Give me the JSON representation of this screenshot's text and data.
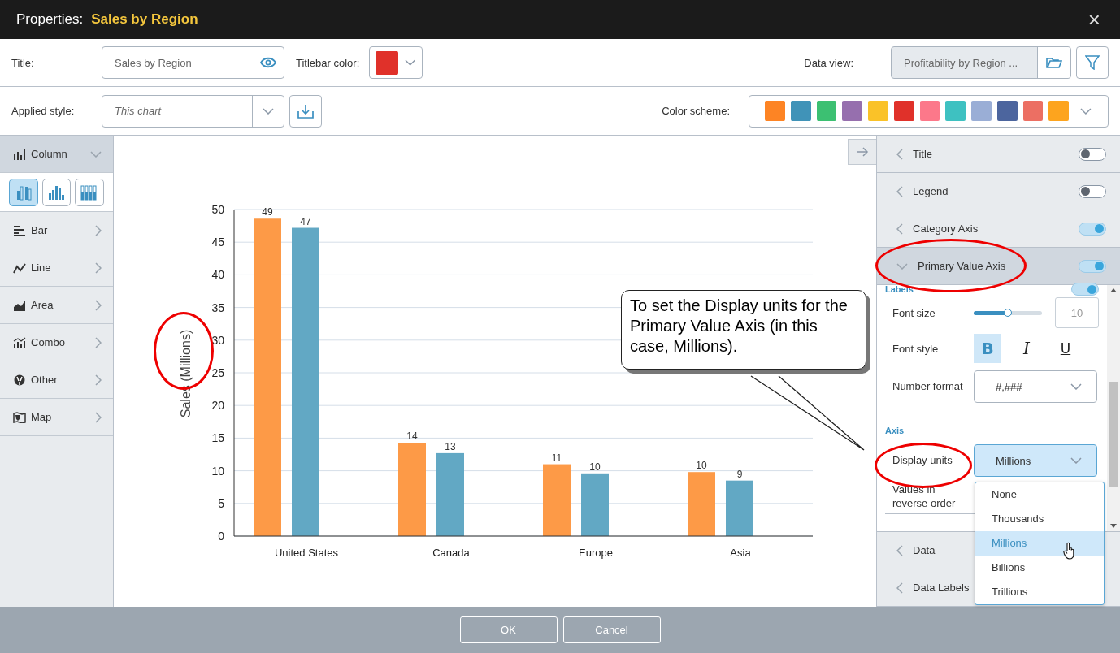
{
  "header": {
    "label": "Properties:",
    "title": "Sales by Region",
    "close": "×"
  },
  "general": {
    "title_label": "Title:",
    "title_value": "Sales by Region",
    "titlebar_color_label": "Titlebar color:",
    "titlebar_swatch": {
      "color": "#e0312a"
    },
    "data_view_label": "Data view:",
    "data_view_value": "Profitability by Region ...",
    "applied_style_label": "Applied style:",
    "applied_style_value": "This chart",
    "color_scheme_label": "Color scheme:",
    "color_scheme": [
      {
        "color": "#fd8424"
      },
      {
        "color": "#4093b8"
      },
      {
        "color": "#3cc072"
      },
      {
        "color": "#966fae"
      },
      {
        "color": "#fac228"
      },
      {
        "color": "#e0312a"
      },
      {
        "color": "#fc788a"
      },
      {
        "color": "#3ec1c1"
      },
      {
        "color": "#9aaed6"
      },
      {
        "color": "#4c659e"
      },
      {
        "color": "#ec6f63"
      },
      {
        "color": "#fda41e"
      }
    ]
  },
  "chart_types": [
    {
      "label": "Column",
      "kind": "column",
      "expanded": true
    },
    {
      "label": "Bar",
      "kind": "bar",
      "expanded": false
    },
    {
      "label": "Line",
      "kind": "line",
      "expanded": false
    },
    {
      "label": "Area",
      "kind": "area",
      "expanded": false
    },
    {
      "label": "Combo",
      "kind": "combo",
      "expanded": false
    },
    {
      "label": "Other",
      "kind": "other",
      "expanded": false
    },
    {
      "label": "Map",
      "kind": "map",
      "expanded": false
    }
  ],
  "column_subtypes": [
    {
      "kind": "clustered",
      "selected": true
    },
    {
      "kind": "mixed",
      "selected": false
    },
    {
      "kind": "stacked",
      "selected": false
    }
  ],
  "chart": {
    "chart_data": {
      "type": "bar",
      "ylabel": "Sales (Millions)",
      "categories": [
        "United States",
        "Canada",
        "Europe",
        "Asia"
      ],
      "series": [
        {
          "color": "#fd9a47",
          "values": [
            48.6,
            14.3,
            11,
            9.8
          ],
          "value_labels": [
            "49",
            "14",
            "11",
            "10"
          ]
        },
        {
          "color": "#62a8c4",
          "values": [
            47.2,
            12.7,
            9.6,
            8.5
          ],
          "value_labels": [
            "47",
            "13",
            "10",
            "9"
          ]
        }
      ],
      "grid": true,
      "ylim": [
        0,
        50
      ],
      "yticks": [
        0,
        5,
        10,
        15,
        20,
        25,
        30,
        35,
        40,
        45,
        50
      ],
      "data_labels": true
    }
  },
  "callout": {
    "text": "To set the Display units for the Primary Value Axis (in this case, Millions)."
  },
  "panel": {
    "sections": [
      {
        "label": "Title",
        "on": false,
        "expanded": false
      },
      {
        "label": "Legend",
        "on": false,
        "expanded": false
      },
      {
        "label": "Category Axis",
        "on": true,
        "expanded": false
      },
      {
        "label": "Primary Value Axis",
        "on": true,
        "expanded": true
      }
    ],
    "labels_heading": "Labels",
    "labels_on": true,
    "font_size": {
      "label": "Font size",
      "level": 0.5,
      "value": "10"
    },
    "font_style": {
      "label": "Font style",
      "buttons": [
        {
          "glyph": "B",
          "kind": "bold",
          "selected": true
        },
        {
          "glyph": "I",
          "kind": "italic",
          "selected": false
        },
        {
          "glyph": "U",
          "kind": "underline",
          "selected": false
        }
      ]
    },
    "number_format": {
      "label": "Number format",
      "value": "#,###"
    },
    "axis_heading": "Axis",
    "display_units": {
      "label": "Display units",
      "value": "Millions",
      "expanded": true
    },
    "reverse_order": {
      "label": "Values in reverse order"
    },
    "menu": [
      {
        "label": "None",
        "selected": false
      },
      {
        "label": "Thousands",
        "selected": false
      },
      {
        "label": "Millions",
        "selected": true
      },
      {
        "label": "Billions",
        "selected": false
      },
      {
        "label": "Trillions",
        "selected": false
      }
    ],
    "lower_sections": [
      {
        "label": "Data",
        "expanded": false
      },
      {
        "label": "Data Labels",
        "expanded": false
      }
    ]
  },
  "footer": {
    "buttons": [
      "OK",
      "Cancel"
    ]
  }
}
